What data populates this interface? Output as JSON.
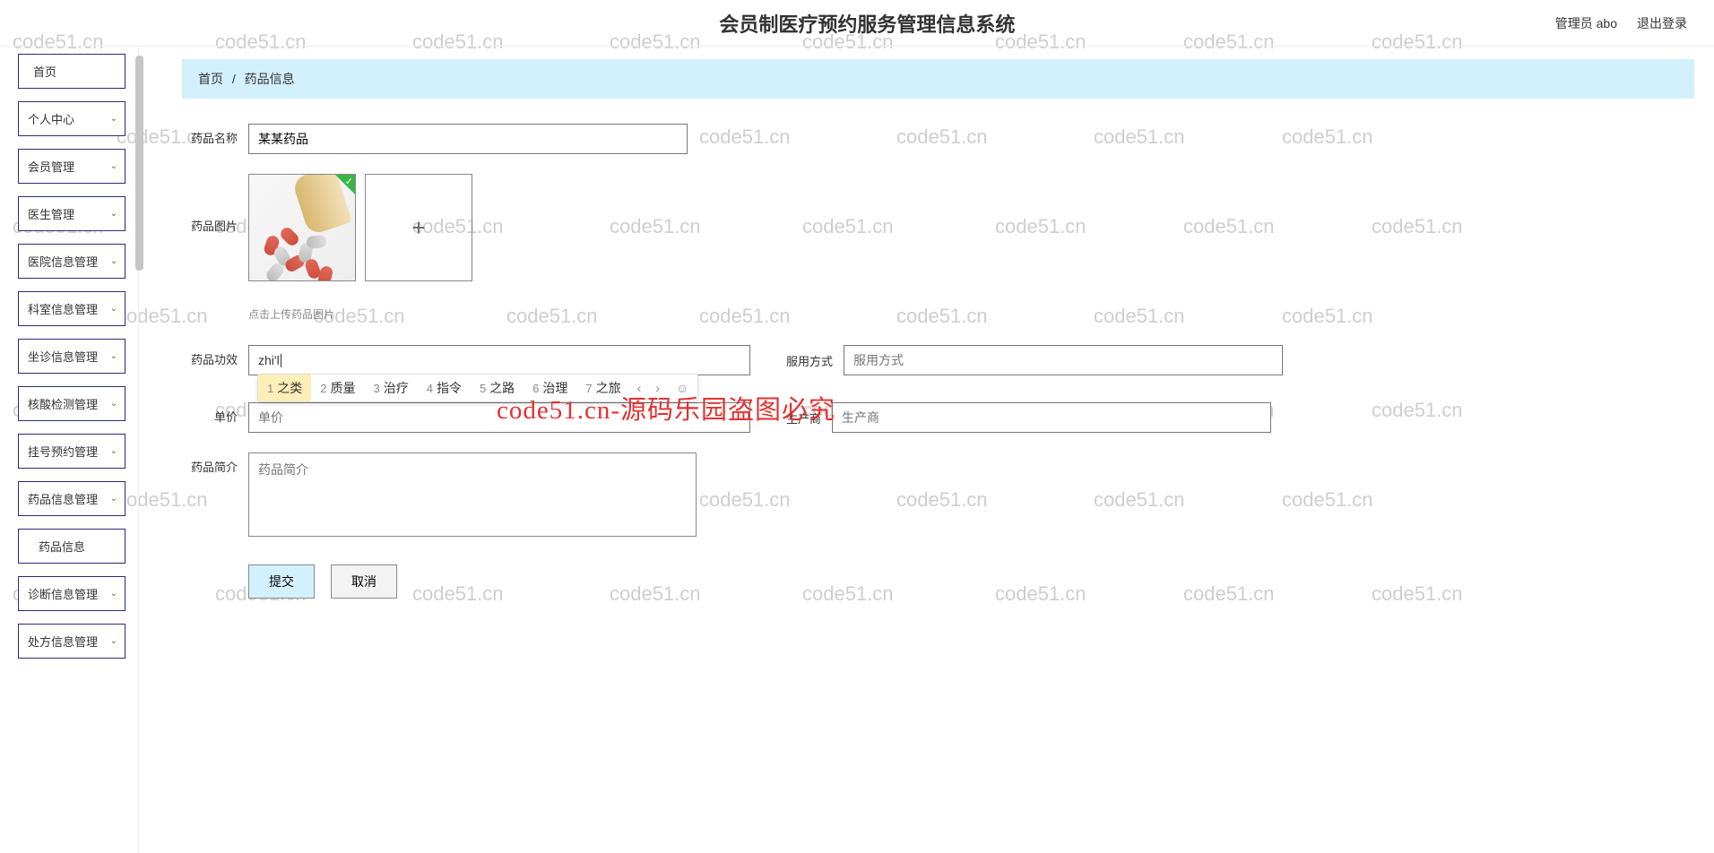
{
  "header": {
    "title": "会员制医疗预约服务管理信息系统",
    "admin_label": "管理员 abo",
    "logout": "退出登录"
  },
  "sidebar": {
    "items": [
      {
        "label": "首页",
        "expandable": false,
        "indent": false
      },
      {
        "label": "个人中心",
        "expandable": true,
        "indent": false
      },
      {
        "label": "会员管理",
        "expandable": true,
        "indent": false
      },
      {
        "label": "医生管理",
        "expandable": true,
        "indent": false
      },
      {
        "label": "医院信息管理",
        "expandable": true,
        "indent": false
      },
      {
        "label": "科室信息管理",
        "expandable": true,
        "indent": false
      },
      {
        "label": "坐诊信息管理",
        "expandable": true,
        "indent": false
      },
      {
        "label": "核酸检测管理",
        "expandable": true,
        "indent": false
      },
      {
        "label": "挂号预约管理",
        "expandable": true,
        "indent": false
      },
      {
        "label": "药品信息管理",
        "expandable": true,
        "indent": false
      },
      {
        "label": "药品信息",
        "expandable": false,
        "indent": true
      },
      {
        "label": "诊断信息管理",
        "expandable": true,
        "indent": false
      },
      {
        "label": "处方信息管理",
        "expandable": true,
        "indent": false
      }
    ]
  },
  "breadcrumb": {
    "root": "首页",
    "sep": "/",
    "current": "药品信息"
  },
  "form": {
    "name_label": "药品名称",
    "name_value": "某某药品",
    "image_label": "药品图片",
    "image_hint": "点击上传药品图片",
    "efficacy_label": "药品功效",
    "efficacy_value": "zhi'l",
    "method_label": "服用方式",
    "method_placeholder": "服用方式",
    "price_label": "单价",
    "price_placeholder": "单价",
    "producer_label": "生产商",
    "producer_placeholder": "生产商",
    "intro_label": "药品简介",
    "intro_placeholder": "药品简介",
    "submit": "提交",
    "cancel": "取消"
  },
  "ime": {
    "candidates": [
      {
        "n": "1",
        "w": "之类"
      },
      {
        "n": "2",
        "w": "质量"
      },
      {
        "n": "3",
        "w": "治疗"
      },
      {
        "n": "4",
        "w": "指令"
      },
      {
        "n": "5",
        "w": "之路"
      },
      {
        "n": "6",
        "w": "治理"
      },
      {
        "n": "7",
        "w": "之旅"
      }
    ]
  },
  "watermark": {
    "text": "code51.cn",
    "overlay": "code51.cn-源码乐园盗图必究"
  }
}
